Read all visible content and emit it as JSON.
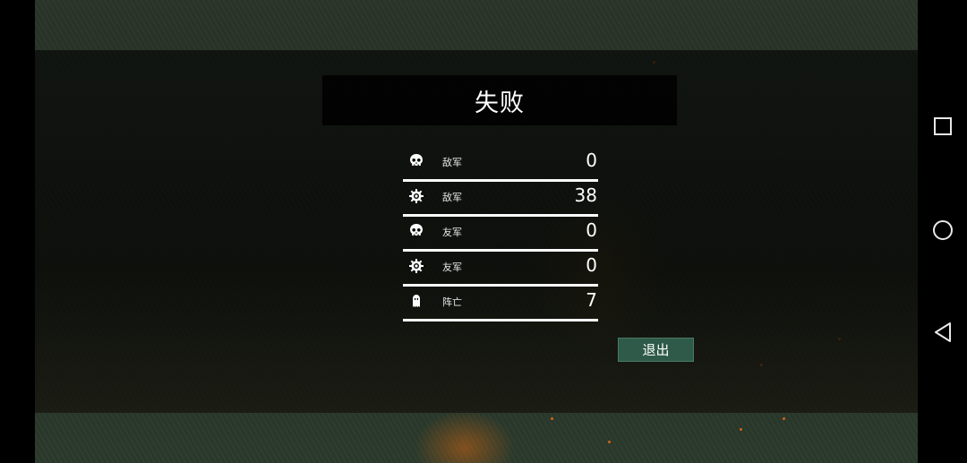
{
  "result": {
    "title": "失败"
  },
  "stats": [
    {
      "icon": "skull-icon",
      "label": "敌军",
      "value": "0"
    },
    {
      "icon": "gear-icon",
      "label": "敌军",
      "value": "38"
    },
    {
      "icon": "skull-icon",
      "label": "友军",
      "value": "0"
    },
    {
      "icon": "gear-icon",
      "label": "友军",
      "value": "0"
    },
    {
      "icon": "ghost-icon",
      "label": "阵亡",
      "value": "7"
    }
  ],
  "actions": {
    "exit_label": "退出"
  },
  "colors": {
    "exit_button": "#2f5a4a",
    "text": "#ffffff",
    "spark": "#d2631c"
  },
  "system_nav": {
    "buttons": [
      "recent-apps-icon",
      "home-icon",
      "back-icon"
    ]
  }
}
